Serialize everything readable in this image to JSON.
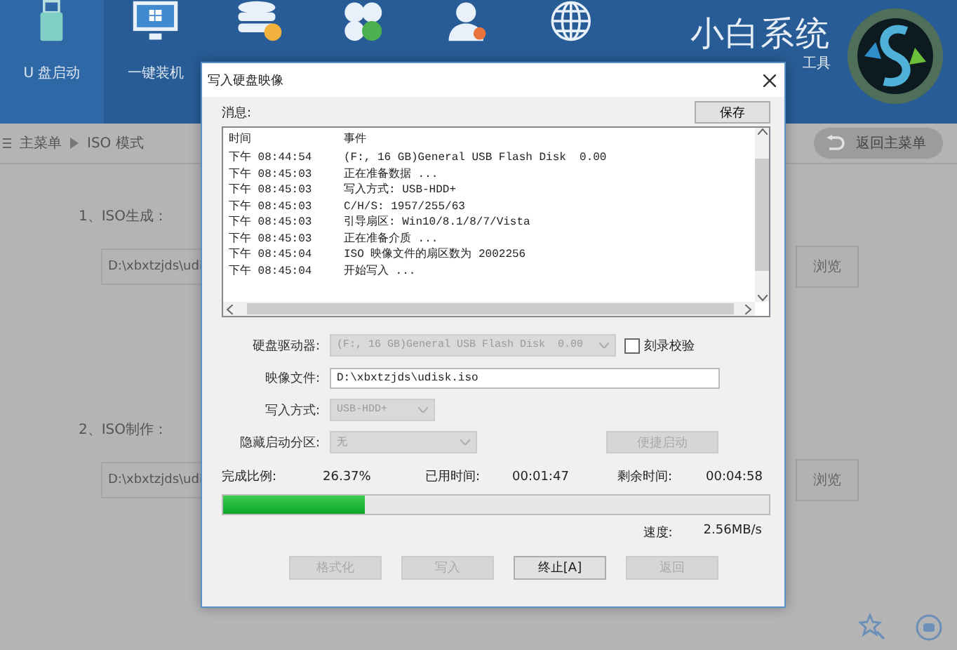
{
  "nav": [
    {
      "kind": "usb",
      "label": "U 盘启动",
      "selected": true
    },
    {
      "kind": "monitor",
      "label": "一键装机",
      "selected": false
    },
    {
      "kind": "database",
      "selected": false
    },
    {
      "kind": "clover",
      "selected": false
    },
    {
      "kind": "user",
      "selected": false
    },
    {
      "kind": "globe",
      "selected": false
    }
  ],
  "brand": {
    "name": "小白系统",
    "subtitle": "工具"
  },
  "breadcrumb": [
    "主菜单",
    "ISO 模式"
  ],
  "back_button": "返回主菜单",
  "sections": [
    {
      "label": "1、ISO生成：",
      "path": "D:\\xbxtzjds\\udi",
      "button": "浏览"
    },
    {
      "label": "2、ISO制作：",
      "path": "D:\\xbxtzjds\\udi",
      "button": "浏览"
    }
  ],
  "dialog": {
    "title": "写入硬盘映像",
    "messages_label": "消息:",
    "save_button": "保存",
    "log": {
      "columns": [
        "时间",
        "事件"
      ],
      "rows": [
        {
          "time": "下午 08:44:54",
          "event": "(F:, 16 GB)General USB Flash Disk  0.00"
        },
        {
          "time": "下午 08:45:03",
          "event": "正在准备数据 ..."
        },
        {
          "time": "下午 08:45:03",
          "event": "写入方式: USB-HDD+"
        },
        {
          "time": "下午 08:45:03",
          "event": "C/H/S: 1957/255/63"
        },
        {
          "time": "下午 08:45:03",
          "event": "引导扇区: Win10/8.1/8/7/Vista"
        },
        {
          "time": "下午 08:45:03",
          "event": "正在准备介质 ..."
        },
        {
          "time": "下午 08:45:04",
          "event": "ISO 映像文件的扇区数为 2002256"
        },
        {
          "time": "下午 08:45:04",
          "event": "开始写入 ..."
        }
      ]
    },
    "drive": {
      "label": "硬盘驱动器:",
      "value": "(F:, 16 GB)General USB Flash Disk  0.00",
      "disabled": true
    },
    "verify": {
      "label": "刻录校验",
      "checked": false
    },
    "image_file": {
      "label": "映像文件:",
      "value": "D:\\xbxtzjds\\udisk.iso"
    },
    "write_mode": {
      "label": "写入方式:",
      "value": "USB-HDD+",
      "disabled": true
    },
    "hidden_partition": {
      "label": "隐藏启动分区:",
      "value": "无",
      "disabled": true
    },
    "quick_start": {
      "label": "便捷启动",
      "disabled": true
    },
    "progress": {
      "done_label": "完成比例:",
      "done": "26.37%",
      "elapsed_label": "已用时间:",
      "elapsed": "00:01:47",
      "remaining_label": "剩余时间:",
      "remaining": "00:04:58",
      "level": 0.26,
      "speed_label": "速度:",
      "speed": "2.56MB/s"
    },
    "buttons": [
      {
        "label": "格式化",
        "disabled": true
      },
      {
        "label": "写入",
        "disabled": true
      },
      {
        "label": "终止[A]",
        "disabled": false
      },
      {
        "label": "返回",
        "disabled": true
      }
    ]
  }
}
